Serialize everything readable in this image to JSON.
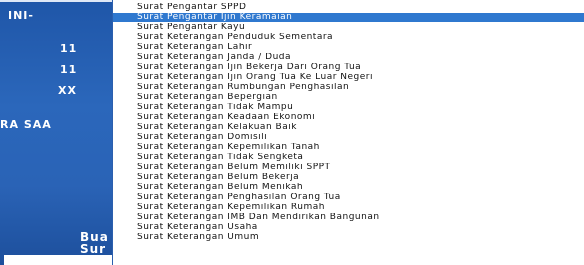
{
  "left_panel": {
    "labels": [
      "INI-",
      "11",
      "11",
      "XX",
      "RA SAA",
      "Bua",
      "Sur"
    ]
  },
  "menu": {
    "items": [
      "Surat Pengantar SPPD",
      "Surat Pengantar Ijin Keramaian",
      "Surat Pengantar Kayu",
      "Surat Keterangan Penduduk Sementara",
      "Surat Keterangan Lahir",
      "Surat Keterangan Janda / Duda",
      "Surat Keterangan Ijin Bekerja Dari Orang Tua",
      "Surat Keterangan Ijin Orang Tua Ke Luar Negeri",
      "Surat Keterangan Rumbungan Penghasilan",
      "Surat Keterangan Bepergian",
      "Surat Keterangan Tidak Mampu",
      "Surat Keterangan Keadaan Ekonomi",
      "Surat Keterangan Kelakuan Baik",
      "Surat Keterangan Domisili",
      "Surat Keterangan Kepemilikan Tanah",
      "Surat Keterangan Tidak Sengketa",
      "Surat Keterangan Belum Memiliki SPPT",
      "Surat Keterangan Belum Bekerja",
      "Surat Keterangan Belum Menikah",
      "Surat Keterangan Penghasilan Orang Tua",
      "Surat Keterangan Kepemilikan Rumah",
      "Surat Keterangan IMB Dan Mendirikan Bangunan",
      "Surat Keterangan Usaha",
      "Surat Keterangan Umum"
    ],
    "selected_index": 1
  },
  "colors": {
    "panel": "#2b67bb",
    "highlight": "#2f78cf"
  }
}
